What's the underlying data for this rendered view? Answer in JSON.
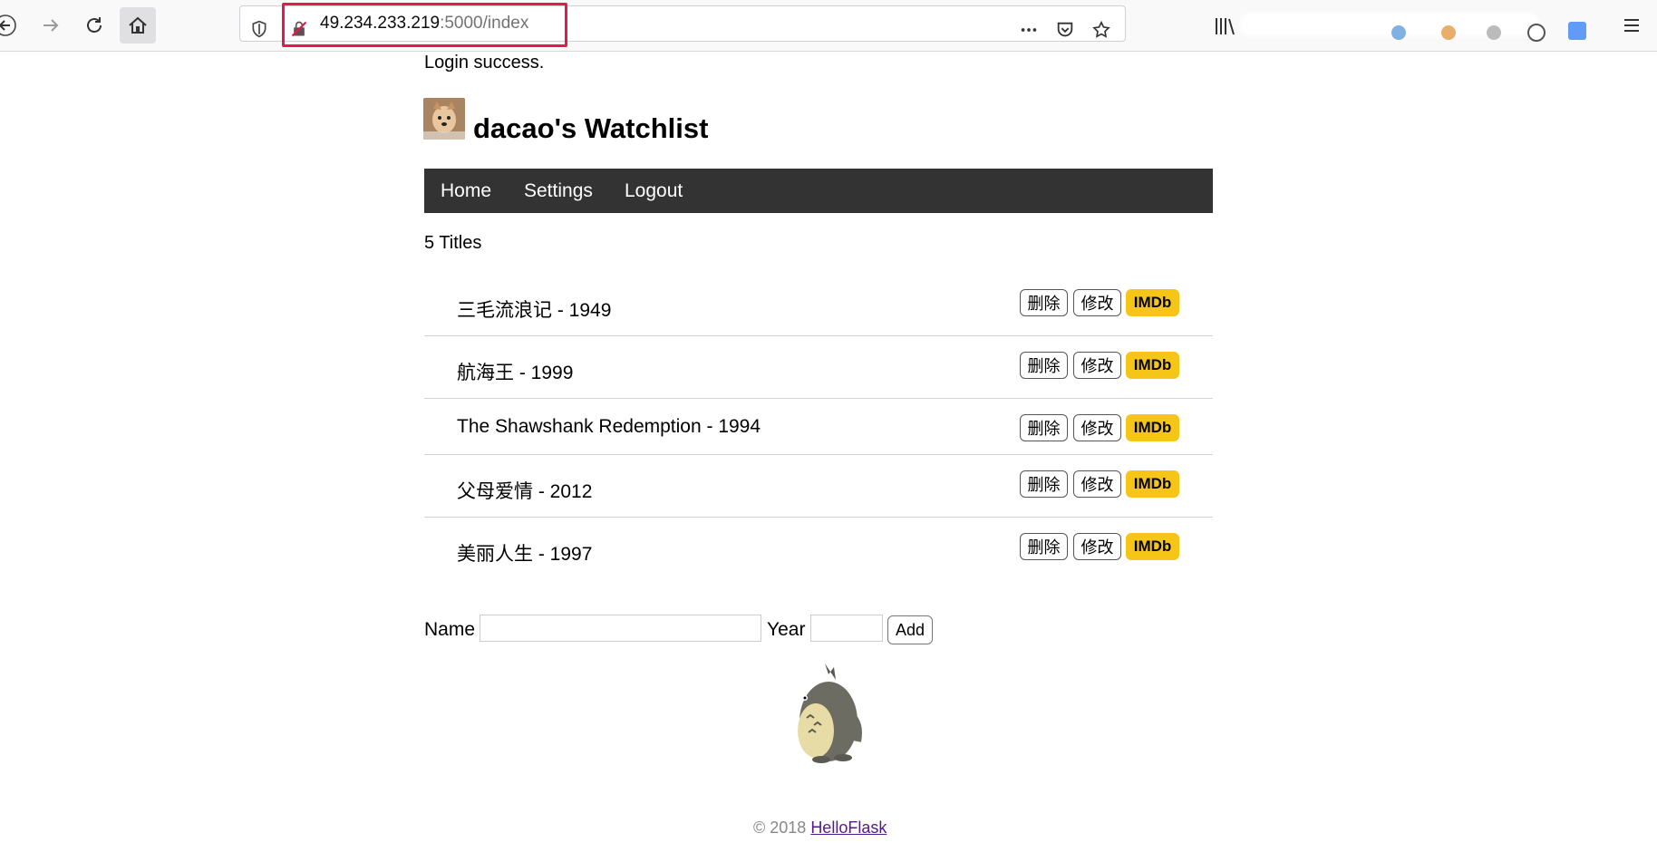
{
  "browser": {
    "url_host": "49.234.233.219",
    "url_path": ":5000/index"
  },
  "flash": "Login success.",
  "header": {
    "title": "dacao's Watchlist"
  },
  "nav": {
    "items": [
      "Home",
      "Settings",
      "Logout"
    ]
  },
  "count_text": "5 Titles",
  "movies": [
    {
      "title": "三毛流浪记 - 1949"
    },
    {
      "title": "航海王 - 1999"
    },
    {
      "title": "The Shawshank Redemption - 1994"
    },
    {
      "title": "父母爱情 - 2012"
    },
    {
      "title": "美丽人生 - 1997"
    }
  ],
  "buttons": {
    "delete": "删除",
    "edit": "修改",
    "imdb": "IMDb"
  },
  "form": {
    "name_label": "Name",
    "year_label": "Year",
    "add_label": "Add",
    "name_value": "",
    "year_value": ""
  },
  "footer": {
    "prefix": "© 2018 ",
    "link": "HelloFlask"
  },
  "colors": {
    "navbar": "#333333",
    "imdb": "#f5c518",
    "url_highlight": "#e5194c",
    "link": "#551a8b"
  }
}
